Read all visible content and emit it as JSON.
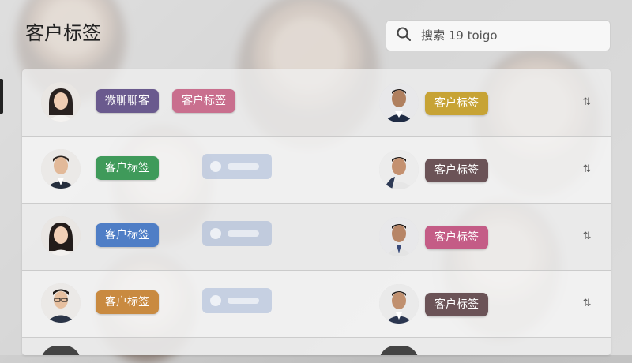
{
  "page_title": "客户标签",
  "search": {
    "placeholder": "搜索 19 toigo",
    "icon": "search-icon"
  },
  "rows": [
    {
      "tags": [
        {
          "label": "微聊聊客",
          "color": "#6a5a8e"
        },
        {
          "label": "客户标签",
          "color": "#c96f8e"
        }
      ],
      "right_tag": {
        "label": "客户标签",
        "color": "#c7a335"
      }
    },
    {
      "tags": [
        {
          "label": "客户标签",
          "color": "#3f9a5a"
        }
      ],
      "right_tag": {
        "label": "客户标签",
        "color": "#6b5357"
      }
    },
    {
      "tags": [
        {
          "label": "客户标签",
          "color": "#4f7ec6"
        }
      ],
      "right_tag": {
        "label": "客户标签",
        "color": "#c45c86"
      }
    },
    {
      "tags": [
        {
          "label": "客户标签",
          "color": "#c98a40"
        }
      ],
      "right_tag": {
        "label": "客户标签",
        "color": "#6b5357"
      }
    }
  ],
  "sort_icon": "sort-arrows-icon",
  "colors": {
    "scrim": "#ebebeb",
    "title": "#222222"
  }
}
